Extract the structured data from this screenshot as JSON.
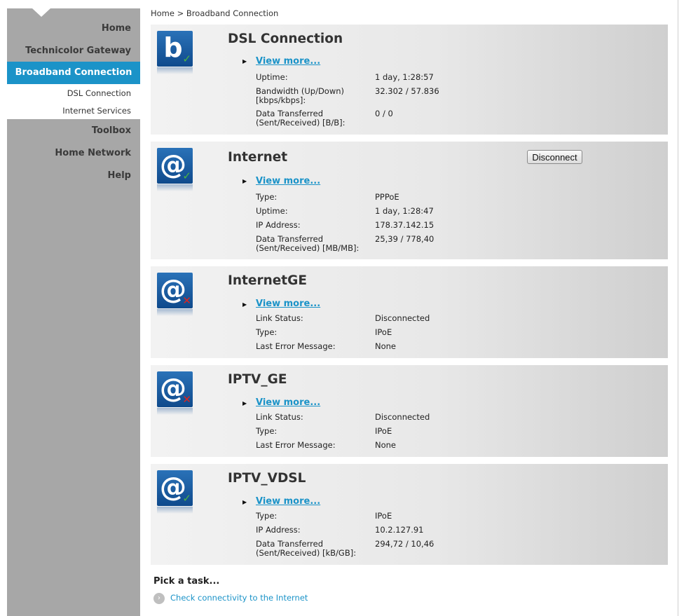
{
  "sidebar": {
    "nav": [
      {
        "label": "Home"
      },
      {
        "label": "Technicolor Gateway"
      },
      {
        "label": "Broadband Connection",
        "active": true
      },
      {
        "label": "Toolbox"
      },
      {
        "label": "Home Network"
      },
      {
        "label": "Help"
      }
    ],
    "subnav": [
      {
        "label": "DSL Connection"
      },
      {
        "label": "Internet Services"
      }
    ]
  },
  "breadcrumb": {
    "home": "Home",
    "separator": ">",
    "current": "Broadband Connection"
  },
  "view_more_label": "View more...",
  "panels": [
    {
      "title": "DSL Connection",
      "icon": "b-broadband-icon",
      "status": "ok",
      "rows": [
        {
          "label": "Uptime:",
          "value": "1 day, 1:28:57"
        },
        {
          "label": "Bandwidth (Up/Down) [kbps/kbps]:",
          "value": "32.302 / 57.836"
        },
        {
          "label": "Data Transferred (Sent/Received) [B/B]:",
          "value": "0 / 0"
        }
      ]
    },
    {
      "title": "Internet",
      "icon": "at-sign-icon",
      "status": "ok",
      "button": "Disconnect",
      "rows": [
        {
          "label": "Type:",
          "value": "PPPoE"
        },
        {
          "label": "Uptime:",
          "value": "1 day, 1:28:47"
        },
        {
          "label": "IP Address:",
          "value": "178.37.142.15"
        },
        {
          "label": "Data Transferred (Sent/Received) [MB/MB]:",
          "value": "25,39 / 778,40"
        }
      ]
    },
    {
      "title": "InternetGE",
      "icon": "at-sign-icon",
      "status": "error",
      "rows": [
        {
          "label": "Link Status:",
          "value": "Disconnected"
        },
        {
          "label": "Type:",
          "value": "IPoE"
        },
        {
          "label": "Last Error Message:",
          "value": "None"
        }
      ]
    },
    {
      "title": "IPTV_GE",
      "icon": "at-sign-icon",
      "status": "error",
      "rows": [
        {
          "label": "Link Status:",
          "value": "Disconnected"
        },
        {
          "label": "Type:",
          "value": "IPoE"
        },
        {
          "label": "Last Error Message:",
          "value": "None"
        }
      ]
    },
    {
      "title": "IPTV_VDSL",
      "icon": "at-sign-icon",
      "status": "ok",
      "rows": [
        {
          "label": "Type:",
          "value": "IPoE"
        },
        {
          "label": "IP Address:",
          "value": "10.2.127.91"
        },
        {
          "label": "Data Transferred (Sent/Received) [kB/GB]:",
          "value": "294,72 / 10,46"
        }
      ]
    }
  ],
  "tasks": {
    "heading": "Pick a task...",
    "items": [
      {
        "label": "Check connectivity to the Internet"
      }
    ]
  },
  "colors": {
    "accent": "#1b93c8",
    "ok": "#4bb543",
    "error": "#e0231c",
    "sidebar": "#a7a7a7"
  }
}
